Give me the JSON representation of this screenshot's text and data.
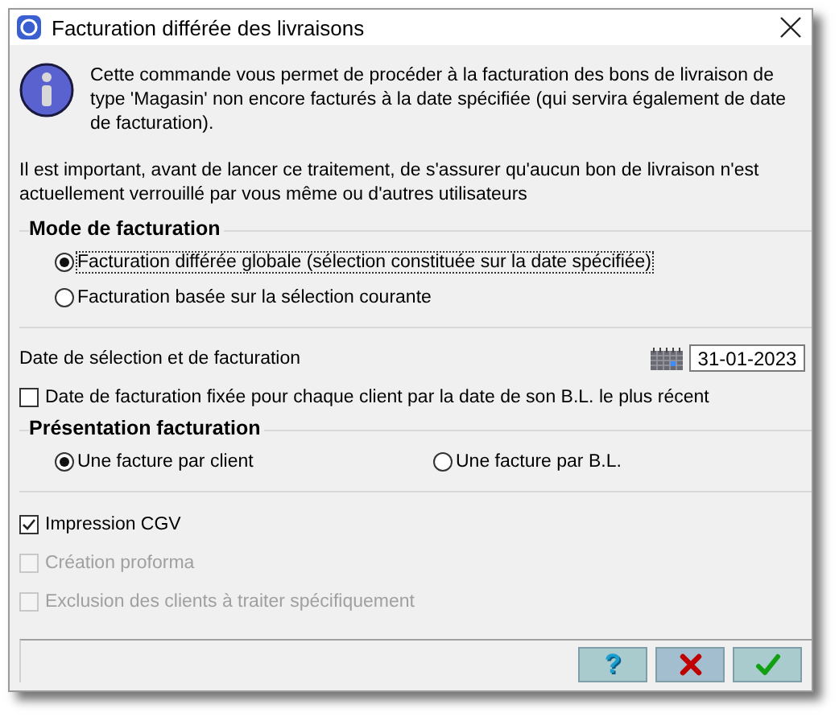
{
  "window": {
    "title": "Facturation différée des livraisons"
  },
  "info": {
    "text": "Cette commande vous permet de procéder à la facturation des bons de livraison de type 'Magasin' non encore facturés à la date spécifiée (qui servira également de date de facturation)."
  },
  "warning": "Il est important, avant de lancer ce traitement, de s'assurer qu'aucun bon de livraison n'est actuellement verrouillé par vous même ou d'autres utilisateurs",
  "mode_group": {
    "title": "Mode de facturation",
    "options": [
      {
        "label": "Facturation différée globale (sélection constituée sur la date spécifiée)",
        "selected": true,
        "focused": true
      },
      {
        "label": "Facturation basée sur la sélection courante",
        "selected": false,
        "focused": false
      }
    ]
  },
  "date": {
    "label": "Date de sélection et de facturation",
    "value": "31-01-2023"
  },
  "latest_date_option": {
    "label": "Date de facturation fixée pour chaque client par la date de son B.L. le plus récent",
    "checked": false
  },
  "presentation_group": {
    "title": "Présentation facturation",
    "options": [
      {
        "label": "Une facture par client",
        "selected": true
      },
      {
        "label": "Une facture par B.L.",
        "selected": false
      }
    ]
  },
  "options": [
    {
      "label": "Impression CGV",
      "checked": true,
      "disabled": false
    },
    {
      "label": "Création proforma",
      "checked": false,
      "disabled": true
    },
    {
      "label": "Exclusion des clients à traiter spécifiquement",
      "checked": false,
      "disabled": true
    }
  ],
  "buttons": [
    {
      "kind": "help",
      "label": "?"
    },
    {
      "kind": "cancel"
    },
    {
      "kind": "ok"
    }
  ]
}
